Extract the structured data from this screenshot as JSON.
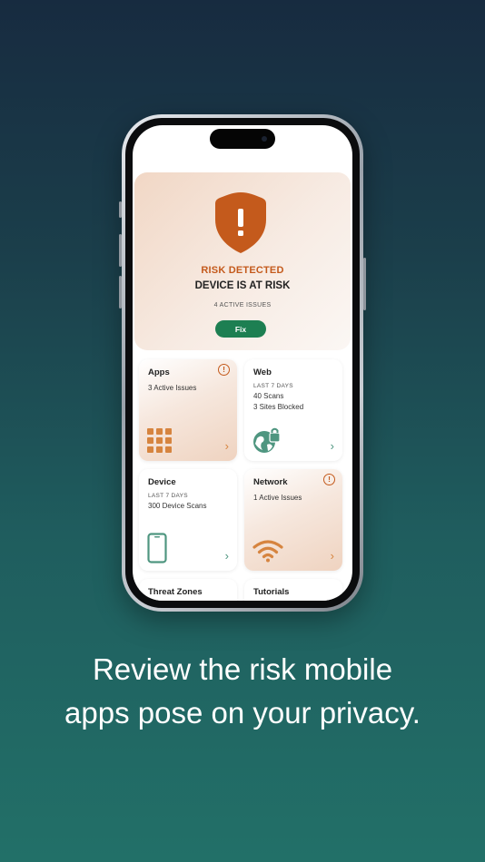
{
  "caption": {
    "line1": "Review the risk mobile",
    "line2": "apps pose on your privacy."
  },
  "risk": {
    "title": "RISK DETECTED",
    "subtitle": "DEVICE IS AT RISK",
    "count": "4 ACTIVE ISSUES",
    "fix_label": "Fix"
  },
  "tiles": {
    "apps": {
      "title": "Apps",
      "line1": "3 Active Issues",
      "warning": "!"
    },
    "web": {
      "title": "Web",
      "period": "LAST 7 DAYS",
      "line1": "40 Scans",
      "line2": "3 Sites Blocked"
    },
    "device": {
      "title": "Device",
      "period": "LAST 7 DAYS",
      "line1": "300 Device Scans"
    },
    "network": {
      "title": "Network",
      "line1": "1 Active Issues",
      "warning": "!"
    },
    "threat_zones": {
      "title": "Threat Zones"
    },
    "tutorials": {
      "title": "Tutorials"
    }
  },
  "icons": {
    "shield": "shield-alert-icon",
    "apps": "grid-icon",
    "web": "globe-lock-icon",
    "device": "phone-icon",
    "network": "wifi-icon",
    "chevron": "›"
  },
  "colors": {
    "alert": "#c45a1c",
    "fix_button": "#1d7f52",
    "app_accent": "#d6843f",
    "web_accent": "#4f9680"
  }
}
